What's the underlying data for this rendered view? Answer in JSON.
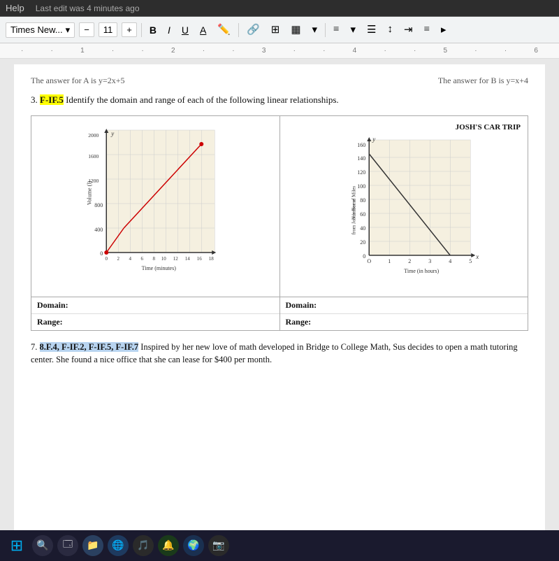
{
  "menubar": {
    "help_label": "Help",
    "last_edit": "Last edit was 4 minutes ago"
  },
  "toolbar": {
    "font_name": "Times New...",
    "font_size": "11",
    "bold": "B",
    "italic": "I",
    "underline": "U",
    "font_color": "A",
    "link_icon": "🔗",
    "image_icon": "⊞",
    "table_icon": "▦",
    "align_icon": "≡",
    "list_icon": "≔",
    "indent_icon": "⇥",
    "more_icon": "≡"
  },
  "previous_answers": {
    "answer_a": "The answer for A is y=2x+5",
    "answer_b": "The answer for B is y=x+4"
  },
  "question3": {
    "number": "3.",
    "standard": "F-IF.5",
    "text": " Identify the domain and range of each of the following linear relationships.",
    "graph1": {
      "title": "y",
      "x_label": "Time (minutes)",
      "y_label": "Volume (l)",
      "y_values": [
        "2000",
        "1600",
        "1200",
        "800",
        "400"
      ],
      "x_values": [
        "0",
        "2",
        "4",
        "6",
        "8",
        "10",
        "12",
        "14",
        "16",
        "18"
      ]
    },
    "graph2": {
      "title": "JOSH'S CAR TRIP",
      "y_label_line1": "Number of Miles",
      "y_label_line2": "from Josh's Home",
      "y_values": [
        "160",
        "140",
        "120",
        "100",
        "80",
        "60",
        "40",
        "20"
      ],
      "x_label": "Time (in hours)",
      "x_values": [
        "O",
        "1",
        "2",
        "3",
        "4",
        "5"
      ]
    },
    "domain_label": "Domain:",
    "range_label": "Range:",
    "domain_label2": "Domain:",
    "range_label2": "Range:"
  },
  "question7": {
    "number": "7.",
    "standard": "8.F.4, F-IF.2, F-IF.5, F-IF.7",
    "text": " Inspired by her new love of math developed in Bridge to College Math, Sus decides to open a math tutoring center. She found a nice office that she can lease for $400 per month."
  },
  "taskbar": {
    "icons": [
      "⊞",
      "🔍",
      "🗔",
      "📁",
      "🌐",
      "🎵",
      "🔔",
      "🌍",
      "📷"
    ]
  }
}
